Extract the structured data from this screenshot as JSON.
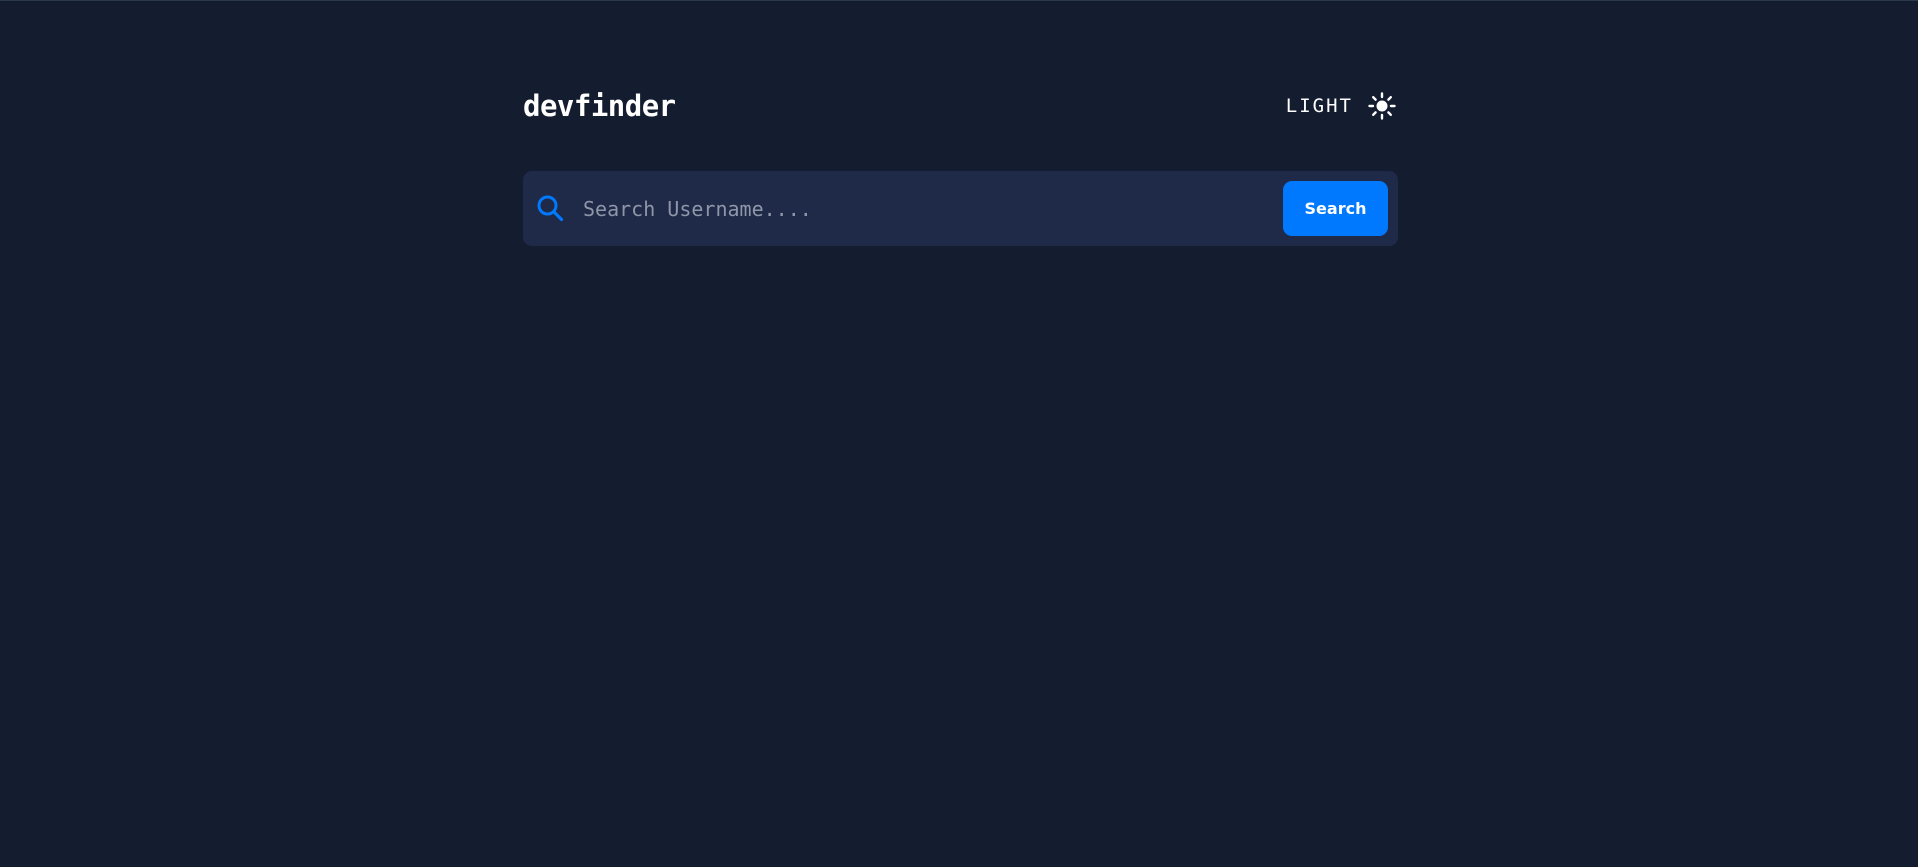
{
  "app": {
    "title": "devfinder"
  },
  "theme_toggle": {
    "label": "LIGHT",
    "icon": "sun-icon"
  },
  "search": {
    "placeholder": "Search Username....",
    "value": "",
    "button_label": "Search",
    "icon": "search-icon"
  },
  "colors": {
    "background": "#141c2f",
    "surface": "#1e2a47",
    "accent": "#0079ff",
    "text": "#ffffff",
    "placeholder": "#8e96a8"
  }
}
